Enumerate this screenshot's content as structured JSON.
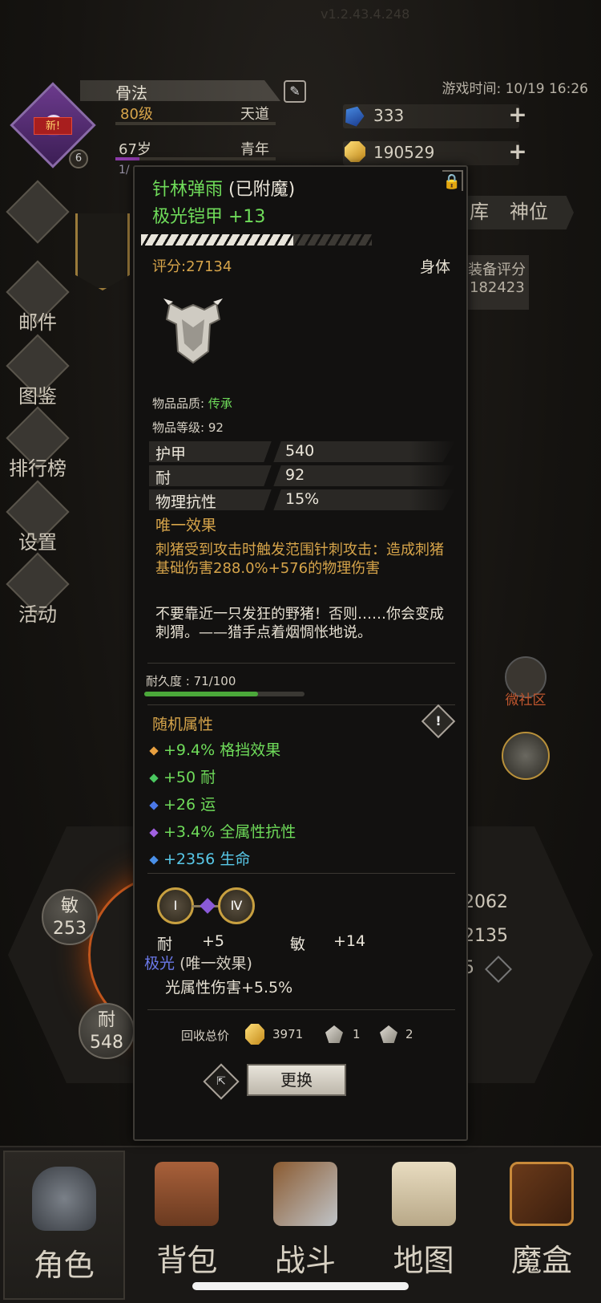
{
  "header": {
    "version": "v1.2.43.4.248",
    "game_time": "游戏时间: 10/19 16:26",
    "player_name": "骨法",
    "level": "80级",
    "realm": "天道",
    "age": "67岁",
    "life_stage": "青年",
    "new_badge": "新!",
    "avatar_level": "6",
    "age_prefix": "1/",
    "blue_gems": "333",
    "gold": "190529"
  },
  "sidebar": {
    "items": [
      {
        "label": "邮件"
      },
      {
        "label": "图鉴"
      },
      {
        "label": "排行榜"
      },
      {
        "label": "设置"
      },
      {
        "label": "活动"
      }
    ]
  },
  "right_tabs": {
    "tab1": "库",
    "tab2": "神位",
    "score_label": "装备评分",
    "score_value": "182423",
    "community": "微社区"
  },
  "stats_panel": {
    "agility_label": "敏",
    "agility_value": "253",
    "stamina_label": "耐",
    "stamina_value": "548",
    "right1": "2062",
    "right2": "2135",
    "right3": "5"
  },
  "item": {
    "name": "针林弹雨",
    "enchanted": "(已附魔)",
    "type_line": "极光铠甲 +13",
    "score": "评分:27134",
    "slot": "身体",
    "quality_label": "物品品质:",
    "quality": "传承",
    "item_level": "物品等级: 92",
    "stats": [
      {
        "k": "护甲",
        "v": "540"
      },
      {
        "k": "耐",
        "v": "92"
      },
      {
        "k": "物理抗性",
        "v": "15%"
      }
    ],
    "unique_header": "唯一效果",
    "unique_text": "刺猪受到攻击时触发范围针刺攻击：造成刺猪基础伤害288.0%+576的物理伤害",
    "lore": "不要靠近一只发狂的野猪！否则……你会变成刺猬。——猎手点着烟惆怅地说。",
    "durability_label": "耐久度 : 71/100",
    "durability": 0.71,
    "random_header": "随机属性",
    "random_stats": [
      {
        "text": "+9.4% 格挡效果",
        "color": "#6fdc5a",
        "dot": "#e8a040"
      },
      {
        "text": "+50 耐",
        "color": "#6fdc5a",
        "dot": "#4ac860"
      },
      {
        "text": "+26 运",
        "color": "#6fdc5a",
        "dot": "#4a78e8"
      },
      {
        "text": "+3.4% 全属性抗性",
        "color": "#6fdc5a",
        "dot": "#a060e0"
      },
      {
        "text": "+2356 生命",
        "color": "#58c8e8",
        "dot": "#4a90e8"
      }
    ],
    "socket1": "Ⅰ",
    "socket2": "Ⅳ",
    "socket_stats": [
      {
        "k": "耐",
        "v": "+5"
      },
      {
        "k": "敏",
        "v": "+14"
      }
    ],
    "aurora_name": "极光",
    "aurora_suffix": "(唯一效果)",
    "aurora_text": "光属性伤害+5.5%",
    "recycle_label": "回收总价",
    "recycle_gold": "3971",
    "recycle_mat1": "1",
    "recycle_mat2": "2",
    "replace_label": "更换"
  },
  "bottom_nav": [
    {
      "label": "角色"
    },
    {
      "label": "背包"
    },
    {
      "label": "战斗"
    },
    {
      "label": "地图"
    },
    {
      "label": "魔盒"
    }
  ]
}
